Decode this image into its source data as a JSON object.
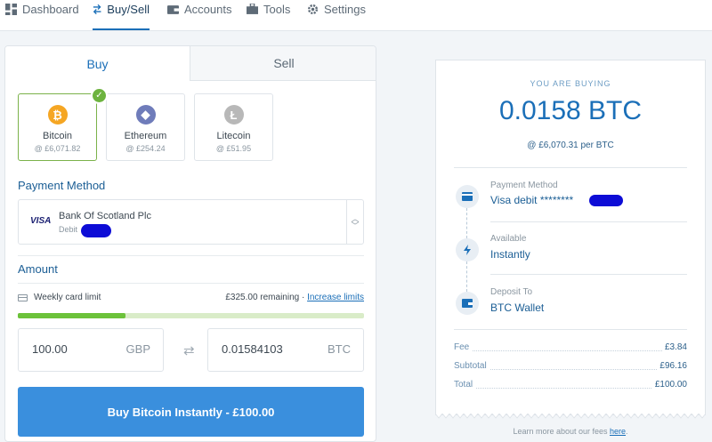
{
  "nav": {
    "items": [
      {
        "label": "Dashboard",
        "icon": "dashboard-icon"
      },
      {
        "label": "Buy/Sell",
        "icon": "swap-arrows-icon",
        "active": true
      },
      {
        "label": "Accounts",
        "icon": "wallet-icon"
      },
      {
        "label": "Tools",
        "icon": "toolbox-icon"
      },
      {
        "label": "Settings",
        "icon": "gear-icon"
      }
    ]
  },
  "tabs": {
    "buy": "Buy",
    "sell": "Sell"
  },
  "coins": [
    {
      "name": "Bitcoin",
      "price": "@ £6,071.82",
      "glyph": "₿",
      "color": "#f5a623",
      "selected": true
    },
    {
      "name": "Ethereum",
      "price": "@ £254.24",
      "glyph": "◆",
      "color": "#6f7cba",
      "selected": false
    },
    {
      "name": "Litecoin",
      "price": "@ £51.95",
      "glyph": "Ł",
      "color": "#b8b8b8",
      "selected": false
    }
  ],
  "payment": {
    "heading": "Payment Method",
    "brand": "VISA",
    "bank": "Bank Of Scotland Plc",
    "type": "Debit"
  },
  "amount": {
    "heading": "Amount",
    "limit_label": "Weekly card limit",
    "remaining": "£325.00 remaining ·",
    "increase_link": "Increase limits",
    "limit_used_fraction": 0.31,
    "fiat_value": "100.00",
    "fiat_currency": "GBP",
    "crypto_value": "0.01584103",
    "crypto_currency": "BTC"
  },
  "buy_button": "Buy Bitcoin Instantly - £100.00",
  "summary": {
    "eyebrow": "YOU ARE BUYING",
    "amount": "0.0158 BTC",
    "rate": "@ £6,070.31 per BTC",
    "steps": [
      {
        "label": "Payment Method",
        "value": "Visa debit ********",
        "icon": "card-icon"
      },
      {
        "label": "Available",
        "value": "Instantly",
        "icon": "lightning-icon"
      },
      {
        "label": "Deposit To",
        "value": "BTC Wallet",
        "icon": "wallet-icon"
      }
    ],
    "fees": [
      {
        "label": "Fee",
        "value": "£3.84"
      },
      {
        "label": "Subtotal",
        "value": "£96.16"
      },
      {
        "label": "Total",
        "value": "£100.00"
      }
    ],
    "learn_prefix": "Learn more about our fees ",
    "learn_link": "here",
    "learn_suffix": "."
  },
  "colors": {
    "accent": "#1b6fb8",
    "button": "#3a8fdd",
    "success": "#6cc23a",
    "redaction": "#0d0cd6"
  }
}
